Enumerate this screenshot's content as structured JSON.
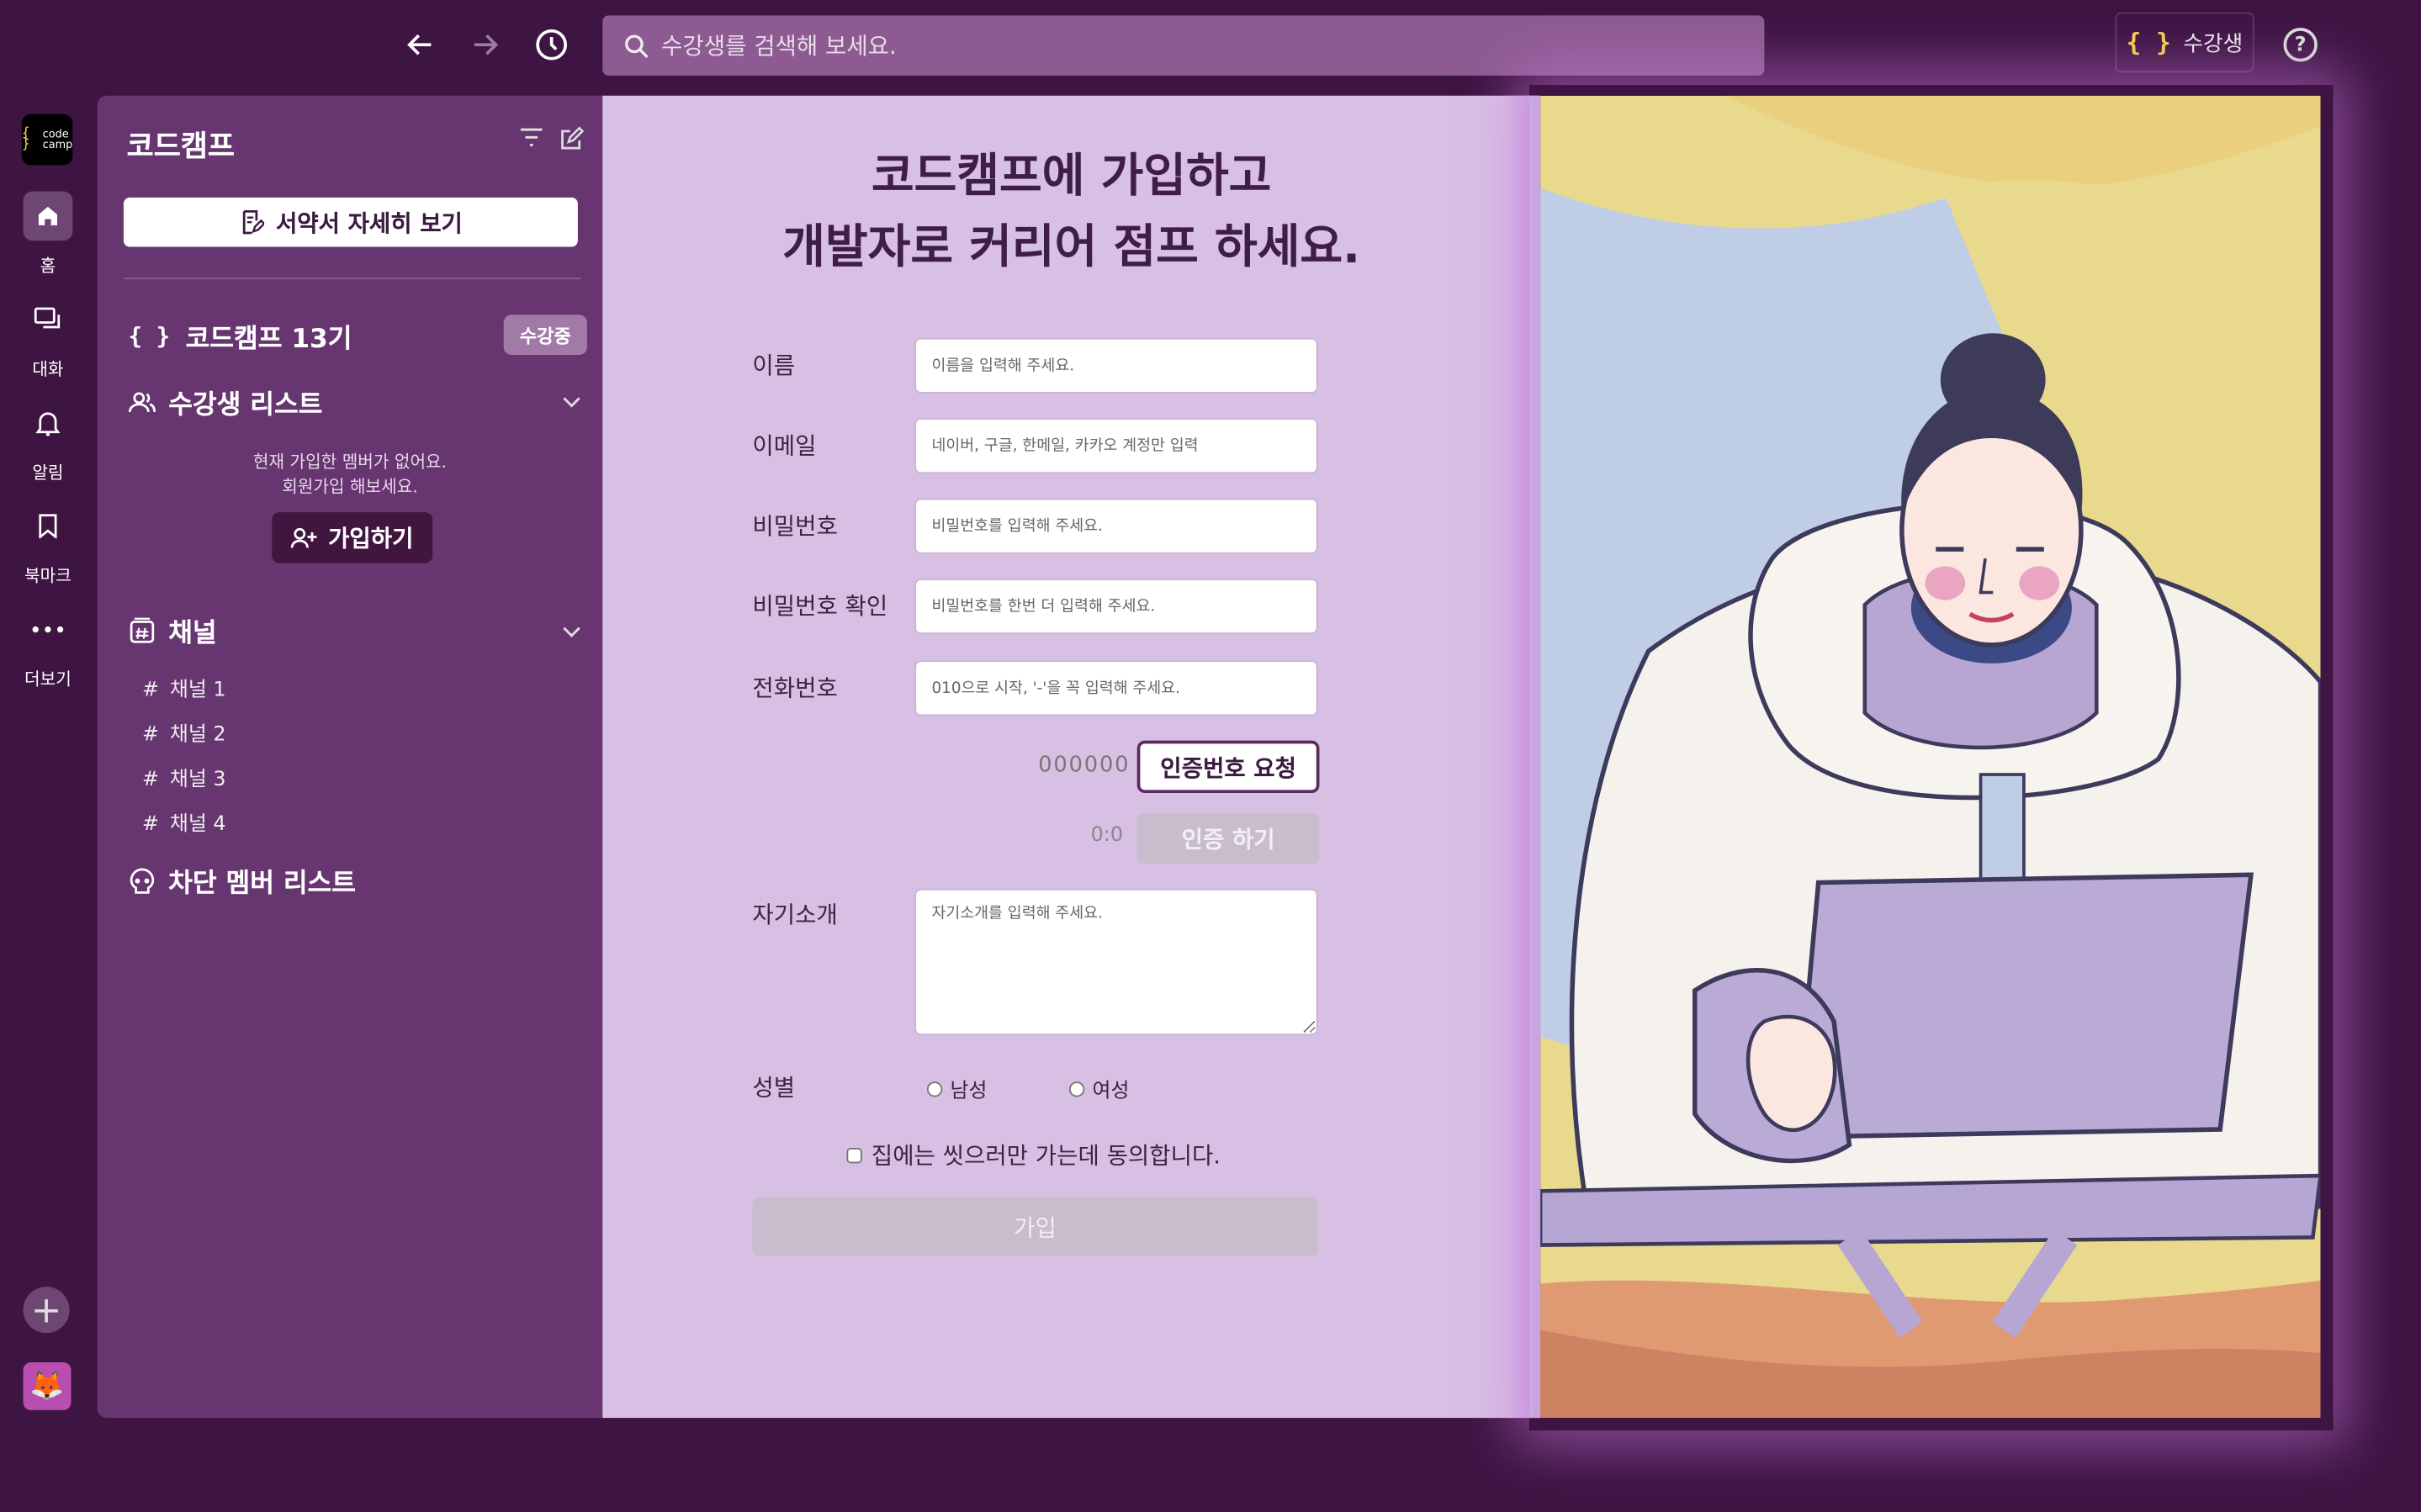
{
  "topbar": {
    "search_placeholder": "수강생를 검색해 보세요.",
    "role_badge_label": "수강생",
    "role_badge_brace": "{ }",
    "help_label": "?"
  },
  "rail": {
    "logo_brace": "{ }",
    "logo_text_1": "code",
    "logo_text_2": "camp",
    "items": [
      {
        "label": "홈",
        "icon": "home-icon"
      },
      {
        "label": "대화",
        "icon": "chat-icon"
      },
      {
        "label": "알림",
        "icon": "bell-icon"
      },
      {
        "label": "북마크",
        "icon": "bookmark-icon"
      },
      {
        "label": "더보기",
        "icon": "more-icon"
      }
    ],
    "add_label": "+",
    "avatar_emoji": "🦊"
  },
  "sidebar": {
    "workspace_title": "코드캠프",
    "terms_button": "서약서 자세히 보기",
    "cohort_brace": "{ }",
    "cohort_name": "코드캠프 13기",
    "cohort_status": "수강중",
    "students_section": "수강생 리스트",
    "empty_line_1": "현재 가입한 멤버가 없어요.",
    "empty_line_2": "회원가입 해보세요.",
    "join_button": "가입하기",
    "channels_section": "채널",
    "channels": [
      "채널 1",
      "채널 2",
      "채널 3",
      "채널 4"
    ],
    "blocked_section": "차단 멤버 리스트"
  },
  "form": {
    "headline_1": "코드캠프에 가입하고",
    "headline_2": "개발자로 커리어 점프 하세요.",
    "name_label": "이름",
    "name_placeholder": "이름을 입력해 주세요.",
    "email_label": "이메일",
    "email_placeholder": "네이버, 구글, 한메일, 카카오 계정만 입력",
    "password_label": "비밀번호",
    "password_placeholder": "비밀번호를 입력해 주세요.",
    "password_confirm_label": "비밀번호 확인",
    "password_confirm_placeholder": "비밀번호를 한번 더 입력해 주세요.",
    "phone_label": "전화번호",
    "phone_placeholder": "010으로 시작, '-'을 꼭 입력해 주세요.",
    "code_display": "000000",
    "request_code_button": "인증번호 요청",
    "timer": "0:0",
    "verify_button": "인증 하기",
    "intro_label": "자기소개",
    "intro_placeholder": "자기소개를 입력해 주세요.",
    "gender_label": "성별",
    "gender_options": [
      "남성",
      "여성"
    ],
    "agree_label": "집에는 씻으러만 가는데 동의합니다.",
    "submit_button": "가입"
  },
  "colors": {
    "background": "#3d1442",
    "sidebar": "#673570",
    "form_panel": "#d7c0e4",
    "accent_dark": "#40163f",
    "brace_yellow": "#f7d24a"
  }
}
